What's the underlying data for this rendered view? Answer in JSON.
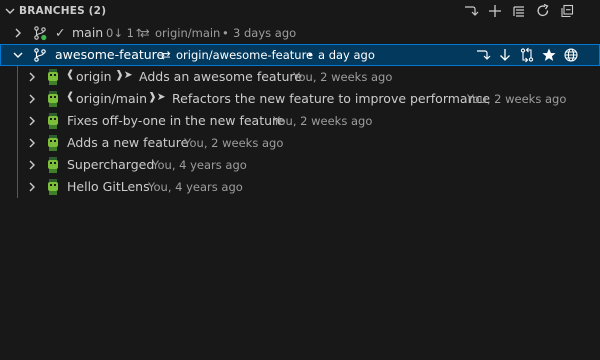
{
  "header": {
    "title": "BRANCHES (2)"
  },
  "branches": [
    {
      "name": "main",
      "status": "0↓ 1↑",
      "upstream": "origin/main",
      "sep": "•",
      "time": "3 days ago",
      "check": "✓"
    },
    {
      "name": "awesome-feature",
      "upstream": "origin/awesome-feature",
      "sep": "•",
      "time": "a day ago"
    }
  ],
  "commits": [
    {
      "refs_open": "❰",
      "refs": "origin",
      "refs_close": "❱➤",
      "message": "Adds an awesome feature",
      "meta": "You, 2 weeks ago"
    },
    {
      "refs_open": "❰",
      "refs": "origin/main",
      "refs_close": "❱➤",
      "message": "Refactors the new feature to improve performance",
      "meta": "You, 2 weeks ago"
    },
    {
      "message": "Fixes off-by-one in the new feature",
      "meta": "You, 2 weeks ago"
    },
    {
      "message": "Adds a new feature",
      "meta": "You, 2 weeks ago"
    },
    {
      "message": "Supercharged",
      "meta": "You, 4 years ago"
    },
    {
      "message": "Hello GitLens",
      "meta": "You, 4 years ago"
    }
  ],
  "icons": {
    "header_actions": [
      "switch-icon",
      "add-icon",
      "list-view-icon",
      "refresh-icon",
      "collapse-all-icon"
    ],
    "row_actions": [
      "switch-icon",
      "fetch-icon",
      "compare-icon",
      "star-icon",
      "globe-icon"
    ]
  },
  "colors": {
    "selection": "#04395e",
    "selection_border": "#0078d4",
    "ahead_dot": "#3fb950",
    "background": "#181818"
  }
}
